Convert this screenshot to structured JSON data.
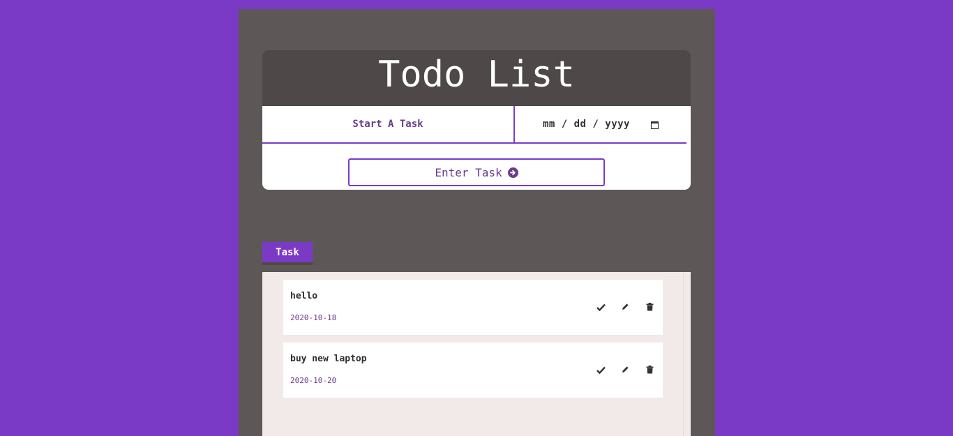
{
  "header": {
    "title": "Todo List"
  },
  "form": {
    "task_placeholder": "Start A Task",
    "date_placeholder": "mm / dd / yyyy",
    "enter_label": "Enter Task"
  },
  "tabs": [
    {
      "label": "Task"
    }
  ],
  "tasks": [
    {
      "name": "hello",
      "date": "2020-10-18"
    },
    {
      "name": "buy new laptop",
      "date": "2020-10-20"
    }
  ],
  "icons": {
    "check": "check-icon",
    "edit": "pencil-icon",
    "delete": "trash-icon",
    "enter": "arrow-circle-right-icon",
    "calendar": "calendar-icon"
  },
  "colors": {
    "page_background": "#7b3ac6",
    "app_background": "#5d5857",
    "title_bar": "#4e4948",
    "accent": "#7b3ac6",
    "text_purple": "#6a3b8f",
    "list_background": "#f2e9e9"
  }
}
